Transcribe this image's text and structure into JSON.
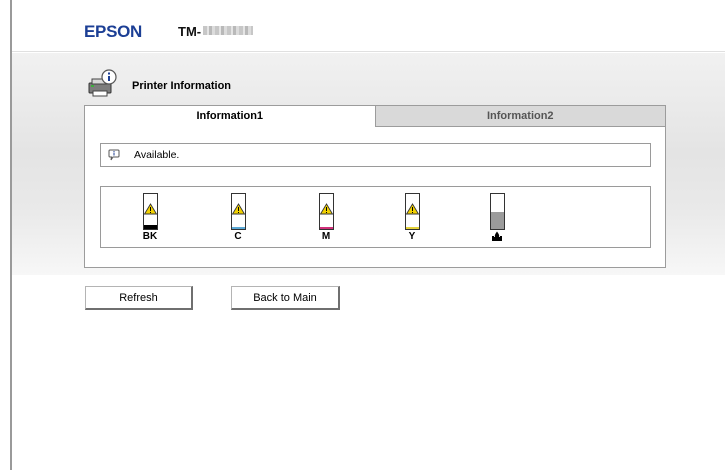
{
  "header": {
    "brand": "EPSON",
    "model_prefix": "TM-"
  },
  "page": {
    "title": "Printer Information"
  },
  "tabs": [
    {
      "label": "Information1",
      "active": true
    },
    {
      "label": "Information2",
      "active": false
    }
  ],
  "status": {
    "icon": "info-bubble-icon",
    "text": "Available."
  },
  "ink": [
    {
      "label": "BK",
      "color": "#000000",
      "state": "warning"
    },
    {
      "label": "C",
      "color": "#5aa9d6",
      "state": "warning"
    },
    {
      "label": "M",
      "color": "#d0307a",
      "state": "warning"
    },
    {
      "label": "Y",
      "color": "#e4d23a",
      "state": "warning"
    }
  ],
  "maintenance_box": {
    "icon": "maintenance-box-icon",
    "fill_fraction": 0.45
  },
  "buttons": {
    "refresh": "Refresh",
    "back": "Back to Main"
  },
  "colors": {
    "brand": "#1c3f95",
    "warning": "#f2d100"
  }
}
